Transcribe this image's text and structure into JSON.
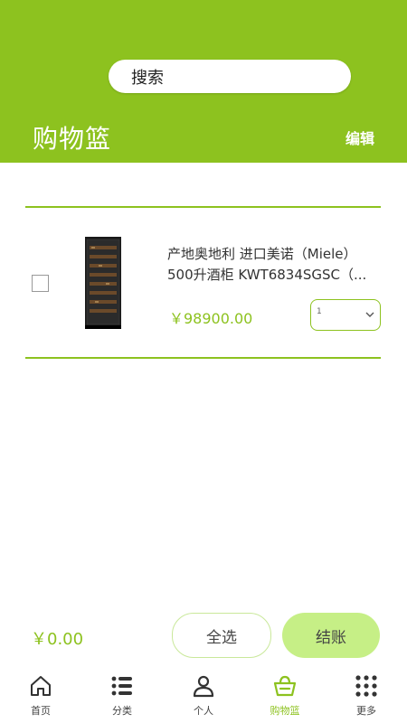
{
  "header": {
    "search_placeholder": "搜索",
    "title": "购物篮",
    "edit_label": "编辑"
  },
  "cart": {
    "items": [
      {
        "name_line1": "产地奥地利 进口美诺（Miele）",
        "name_line2": "500升酒柜 KWT6834SGSC（...",
        "price": "￥98900.00",
        "quantity_display": "1",
        "checked": false
      }
    ]
  },
  "footer": {
    "total": "￥0.00",
    "select_all_label": "全选",
    "checkout_label": "结账"
  },
  "tabs": [
    {
      "label": "首页",
      "icon": "home-icon",
      "active": false
    },
    {
      "label": "分类",
      "icon": "list-icon",
      "active": false
    },
    {
      "label": "个人",
      "icon": "user-icon",
      "active": false
    },
    {
      "label": "购物篮",
      "icon": "basket-icon",
      "active": true
    },
    {
      "label": "更多",
      "icon": "grid-icon",
      "active": false
    }
  ],
  "colors": {
    "brand": "#8dc21f",
    "checkout_bg": "#c6ef86"
  }
}
